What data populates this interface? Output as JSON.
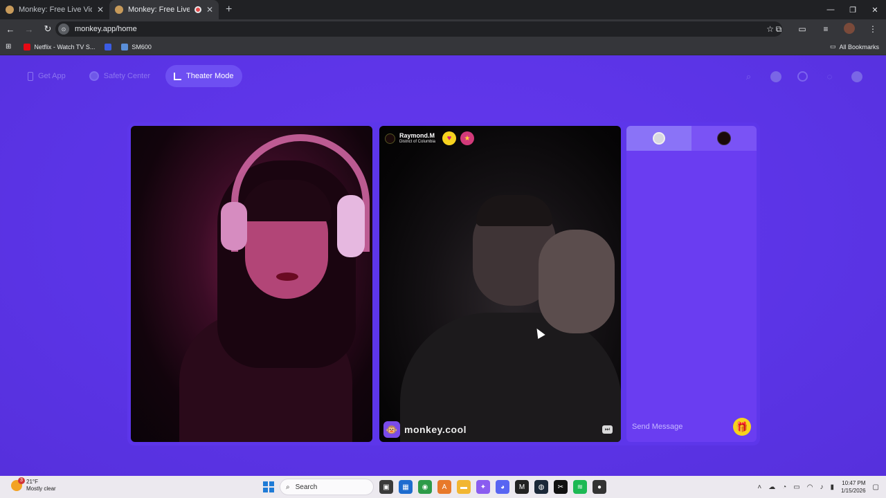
{
  "browser": {
    "tabs": [
      {
        "title": "Monkey: Free Live Video Chat",
        "active": false
      },
      {
        "title": "Monkey: Free Live Video Ch",
        "active": true
      }
    ],
    "new_tab_icon": "plus-icon",
    "url": "monkey.app/home",
    "bookmarks": [
      {
        "label": "Netflix - Watch TV S...",
        "color": "#e50914"
      },
      {
        "label": "",
        "color": "#3b5ce4"
      },
      {
        "label": "SM600",
        "color": "#5a8fd8"
      }
    ],
    "all_bookmarks": "All Bookmarks"
  },
  "topnav": {
    "get_app": "Get App",
    "safety_center": "Safety Center",
    "theater_mode": "Theater Mode"
  },
  "remote_user": {
    "name": "Raymond.M",
    "location": "District of Columbia"
  },
  "watermark": "monkey.cool",
  "chat": {
    "placeholder": "Send Message"
  },
  "taskbar": {
    "weather_temp": "21°F",
    "weather_desc": "Mostly clear",
    "weather_badge": "3",
    "search_label": "Search",
    "time": "10:47 PM",
    "date": "1/15/2026"
  },
  "colors": {
    "page_bg": "#5b34e6",
    "chat_bg": "#6a3df1",
    "accent_yellow": "#f7d21d"
  }
}
